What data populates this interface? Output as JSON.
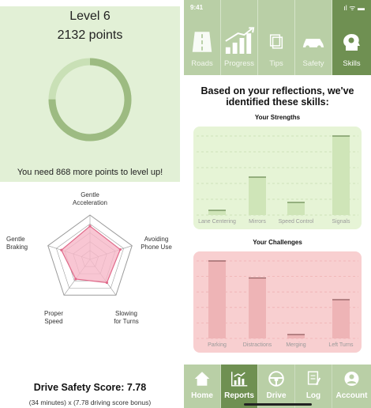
{
  "level_card": {
    "level": "Level 6",
    "points": "2132 points",
    "progress": 0.75,
    "levelup_message": "You need 868 more points to level up!"
  },
  "radar": {
    "labels": {
      "top": "Gentle\nAcceleration",
      "right": "Avoiding\nPhone Use",
      "bottom_right": "Slowing\nfor Turns",
      "bottom_left": "Proper\nSpeed",
      "left": "Gentle\nBraking"
    },
    "values": [
      0.75,
      0.72,
      0.65,
      0.55,
      0.68
    ],
    "colors": {
      "fill": "#f6b8c8",
      "stroke": "#e06a8a"
    }
  },
  "score": {
    "title": "Drive Safety Score: 7.78",
    "formula": "(34 minutes) x (7.78 driving score bonus)"
  },
  "phone": {
    "status": {
      "time": "9:41",
      "icons": "ıl ᯤ ▬"
    },
    "top_tabs": [
      {
        "label": "Roads",
        "icon": "road-icon"
      },
      {
        "label": "Progress",
        "icon": "chart-up-icon"
      },
      {
        "label": "Tips",
        "icon": "tips-icon"
      },
      {
        "label": "Safety",
        "icon": "car-icon"
      },
      {
        "label": "Skills",
        "icon": "brain-head-icon",
        "active": true
      }
    ],
    "headline": "Based on your reflections, we've identified these skills:",
    "strengths_title": "Your Strengths",
    "challenges_title": "Your Challenges",
    "bottom_tabs": [
      {
        "label": "Home",
        "icon": "home-icon"
      },
      {
        "label": "Reports",
        "icon": "reports-icon",
        "active": true
      },
      {
        "label": "Drive",
        "icon": "steering-wheel-icon"
      },
      {
        "label": "Log",
        "icon": "log-icon"
      },
      {
        "label": "Account",
        "icon": "account-icon"
      }
    ],
    "colors": {
      "nav": "#b9cfa6",
      "active": "#6f9052"
    }
  },
  "chart_data": [
    {
      "type": "bar",
      "title": "Your Strengths",
      "categories": [
        "Lane Centering",
        "Mirrors",
        "Speed Control",
        "Signals"
      ],
      "values": [
        0.06,
        0.48,
        0.16,
        1.0
      ],
      "ylim": [
        0,
        1
      ],
      "grid": true
    },
    {
      "type": "bar",
      "title": "Your Challenges",
      "categories": [
        "Parking",
        "Distractions",
        "Merging",
        "Left Turns"
      ],
      "values": [
        1.0,
        0.78,
        0.05,
        0.5
      ],
      "ylim": [
        0,
        1
      ],
      "grid": true
    }
  ]
}
